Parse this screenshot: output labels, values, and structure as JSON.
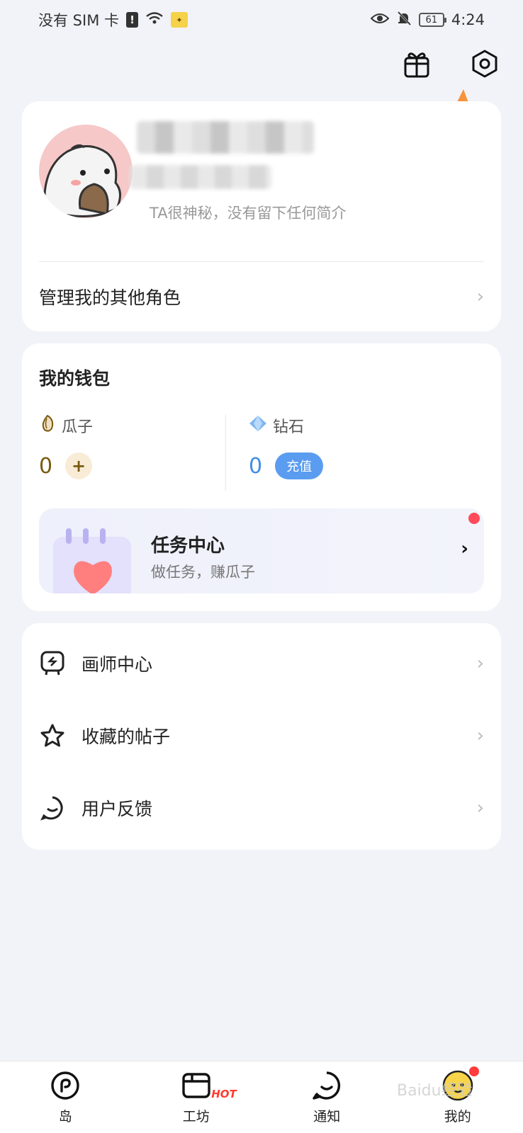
{
  "status_bar": {
    "carrier": "没有 SIM 卡",
    "battery": "61",
    "time": "4:24"
  },
  "profile": {
    "bio": "TA很神秘，没有留下任何简介",
    "manage_roles_label": "管理我的其他角色"
  },
  "wallet": {
    "title": "我的钱包",
    "seeds_label": "瓜子",
    "seeds_value": "0",
    "seeds_add": "+",
    "diamonds_label": "钻石",
    "diamonds_value": "0",
    "recharge_label": "充值"
  },
  "task": {
    "title": "任务中心",
    "subtitle": "做任务，赚瓜子"
  },
  "menu": {
    "items": [
      {
        "label": "画师中心",
        "icon": "artist-icon"
      },
      {
        "label": "收藏的帖子",
        "icon": "star-icon"
      },
      {
        "label": "用户反馈",
        "icon": "feedback-icon"
      }
    ]
  },
  "bottom_nav": {
    "items": [
      {
        "label": "岛",
        "icon": "island-icon"
      },
      {
        "label": "工坊",
        "icon": "workshop-icon",
        "badge": "HOT"
      },
      {
        "label": "通知",
        "icon": "chat-icon"
      },
      {
        "label": "我的",
        "icon": "avatar-icon"
      }
    ]
  },
  "watermark": "Baidu经验",
  "colors": {
    "background": "#f2f3f8",
    "recharge": "#5a9cf0",
    "diamond": "#3f8de6",
    "seed": "#7a5a10",
    "hot": "#ff3b2f",
    "annotation_arrow": "#f7933a"
  }
}
